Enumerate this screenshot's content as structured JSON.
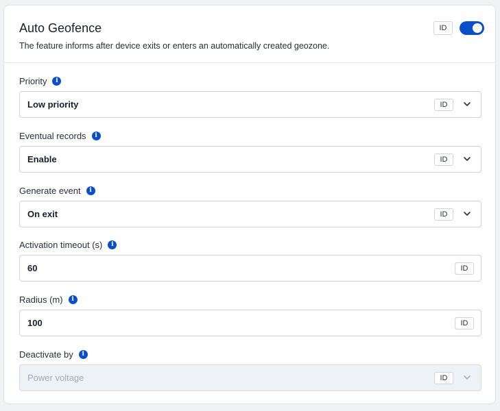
{
  "header": {
    "title": "Auto Geofence",
    "description": "The feature informs after device exits or enters an automatically created geozone.",
    "id_badge": "ID",
    "toggle_on": true
  },
  "fields": [
    {
      "label": "Priority",
      "value": "Low priority",
      "badge": "ID",
      "type": "select"
    },
    {
      "label": "Eventual records",
      "value": "Enable",
      "badge": "ID",
      "type": "select"
    },
    {
      "label": "Generate event",
      "value": "On exit",
      "badge": "ID",
      "type": "select"
    },
    {
      "label": "Activation timeout (s)",
      "value": "60",
      "badge": "ID",
      "type": "input"
    },
    {
      "label": "Radius (m)",
      "value": "100",
      "badge": "ID",
      "type": "input"
    },
    {
      "label": "Deactivate by",
      "value": "Power voltage",
      "badge": "ID",
      "type": "select-disabled"
    }
  ],
  "colors": {
    "accent": "#0a4fc9",
    "disabled_bg": "#eef1f5",
    "disabled_text": "#a3aab7"
  },
  "icons": {
    "info": "info-icon",
    "dropdown": "chevron-down-icon"
  }
}
